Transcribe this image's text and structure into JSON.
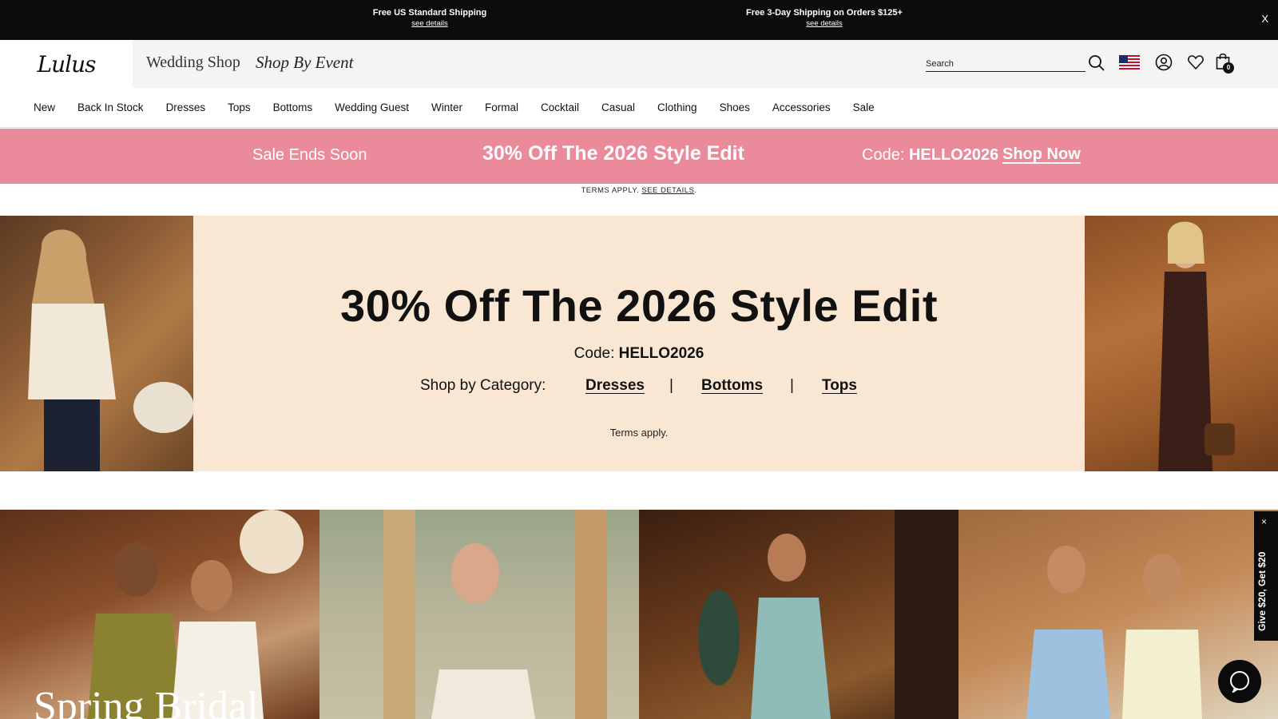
{
  "topbar": {
    "promo1_title": "Free US Standard Shipping",
    "promo1_link": "see details",
    "promo2_title": "Free 3-Day Shipping on Orders $125+",
    "promo2_link": "see details",
    "close": "X"
  },
  "header": {
    "logo": "Lulus",
    "wedding_shop": "Wedding Shop",
    "shop_by_event": "Shop By Event",
    "search_placeholder": "Search",
    "bag_count": "0",
    "icons": [
      "search-icon",
      "us-flag-icon",
      "account-icon",
      "heart-icon",
      "shopping-bag-icon"
    ]
  },
  "nav": {
    "items": [
      "New",
      "Back In Stock",
      "Dresses",
      "Tops",
      "Bottoms",
      "Wedding Guest",
      "Winter",
      "Formal",
      "Cocktail",
      "Casual",
      "Clothing",
      "Shoes",
      "Accessories",
      "Sale"
    ]
  },
  "banner": {
    "ends": "Sale Ends Soon",
    "headline": "30% Off The 2026 Style Edit",
    "code_label": "Code:",
    "code": "HELLO2026",
    "shop_now": "Shop Now",
    "color": "#ea8a9a"
  },
  "terms_line": {
    "prefix": "TERMS APPLY.",
    "link": "SEE DETAILS",
    "suffix": "."
  },
  "hero": {
    "title": "30% Off The 2026 Style Edit",
    "code_label": "Code:",
    "code": "HELLO2026",
    "category_label": "Shop by Category:",
    "categories": [
      "Dresses",
      "Bottoms",
      "Tops"
    ],
    "separator": "|",
    "terms": "Terms apply.",
    "background": "#fae7d3"
  },
  "tiles": {
    "title_partial": "Spring Bridal"
  },
  "side_tab": {
    "text": "Give $20, Get $20",
    "close": "×"
  }
}
